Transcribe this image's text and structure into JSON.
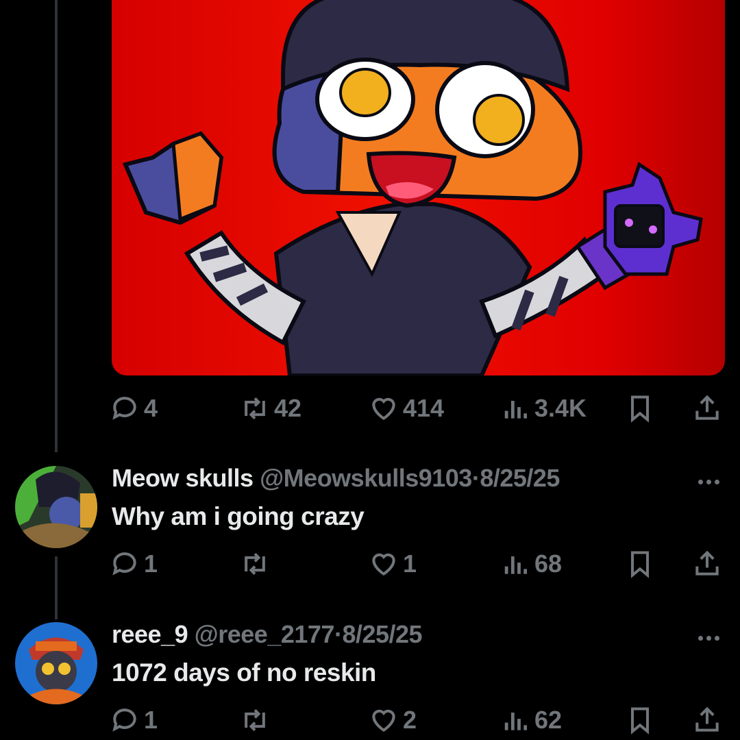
{
  "post": {
    "image_alt": "",
    "stats": {
      "replies": "4",
      "reposts": "42",
      "likes": "414",
      "views": "3.4K"
    }
  },
  "replies": [
    {
      "name": "Meow skulls",
      "handle": "@Meowskulls9103",
      "separator": "·",
      "date": "8/25/25",
      "text": "Why am i going crazy",
      "stats": {
        "replies": "1",
        "reposts": "",
        "likes": "1",
        "views": "68"
      }
    },
    {
      "name": "reee_9",
      "handle": "@reee_2177",
      "separator": "·",
      "date": "8/25/25",
      "text": "1072 days of no reskin",
      "stats": {
        "replies": "1",
        "reposts": "",
        "likes": "2",
        "views": "62"
      }
    }
  ],
  "icons": {
    "reply": "speech-bubble-icon",
    "repost": "repost-arrows-icon",
    "like": "heart-icon",
    "views": "bar-chart-icon",
    "bookmark": "bookmark-icon",
    "share": "share-upload-icon",
    "more": "ellipsis-icon"
  },
  "colors": {
    "background": "#000000",
    "text": "#e7e9ea",
    "muted": "#71767b",
    "image_bg": "#e00000"
  }
}
